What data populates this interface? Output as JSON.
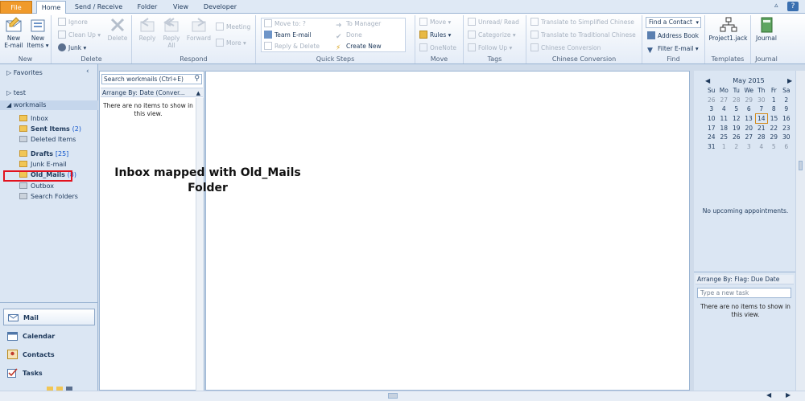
{
  "tabs": [
    "File",
    "Home",
    "Send / Receive",
    "Folder",
    "View",
    "Developer"
  ],
  "groups": {
    "new": "New",
    "delete": "Delete",
    "respond": "Respond",
    "quick_steps": "Quick Steps",
    "move": "Move",
    "tags": "Tags",
    "chinese": "Chinese Conversion",
    "find": "Find",
    "templates": "Templates",
    "journal": "Journal"
  },
  "ribbon": {
    "new_email": "New\nE-mail",
    "new_items": "New\nItems ▾",
    "ignore": "Ignore",
    "clean_up": "Clean Up ▾",
    "junk": "Junk ▾",
    "delete": "Delete",
    "reply": "Reply",
    "reply_all": "Reply\nAll",
    "forward": "Forward",
    "meeting": "Meeting",
    "more": "More ▾",
    "qs_move_to": "Move to: ?",
    "qs_team": "Team E-mail",
    "qs_reply_delete": "Reply & Delete",
    "qs_manager": "To Manager",
    "qs_done": "Done",
    "qs_create": "Create New",
    "move": "Move ▾",
    "rules": "Rules ▾",
    "onenote": "OneNote",
    "unread": "Unread/ Read",
    "categorize": "Categorize ▾",
    "follow_up": "Follow Up ▾",
    "to_simplified": "Translate to Simplified Chinese",
    "to_traditional": "Translate to Traditional Chinese",
    "chinese_conversion": "Chinese Conversion",
    "find_contact": "Find a Contact",
    "address_book": "Address Book",
    "filter_email": "Filter E-mail ▾",
    "project": "Project1.jack",
    "journal_btn": "Journal"
  },
  "nav": {
    "favorites": "Favorites",
    "test": "test",
    "workmails": "workmails",
    "folders": [
      {
        "name": "Inbox",
        "count": ""
      },
      {
        "name": "Sent Items",
        "count": "(2)"
      },
      {
        "name": "Deleted Items",
        "count": ""
      },
      {
        "name": "Drafts",
        "count": "[25]"
      },
      {
        "name": "Junk E-mail",
        "count": ""
      },
      {
        "name": "Old_Mails",
        "count": "(8)"
      },
      {
        "name": "Outbox",
        "count": ""
      },
      {
        "name": "Search Folders",
        "count": ""
      }
    ],
    "buttons": [
      "Mail",
      "Calendar",
      "Contacts",
      "Tasks"
    ]
  },
  "list": {
    "search_placeholder": "Search workmails (Ctrl+E)",
    "arrange": "Arrange By: Date (Conver...",
    "empty": "There are no items to show in this view."
  },
  "annotation": {
    "line1": "Inbox mapped with Old_Mails",
    "line2": "Folder"
  },
  "todo": {
    "month": "May 2015",
    "days": [
      "Su",
      "Mo",
      "Tu",
      "We",
      "Th",
      "Fr",
      "Sa"
    ],
    "weeks": [
      [
        "26",
        "27",
        "28",
        "29",
        "30",
        "1",
        "2"
      ],
      [
        "3",
        "4",
        "5",
        "6",
        "7",
        "8",
        "9"
      ],
      [
        "10",
        "11",
        "12",
        "13",
        "14",
        "15",
        "16"
      ],
      [
        "17",
        "18",
        "19",
        "20",
        "21",
        "22",
        "23"
      ],
      [
        "24",
        "25",
        "26",
        "27",
        "28",
        "29",
        "30"
      ],
      [
        "31",
        "1",
        "2",
        "3",
        "4",
        "5",
        "6"
      ]
    ],
    "today": "14",
    "no_appts": "No upcoming appointments.",
    "arrange": "Arrange By: Flag: Due Date",
    "task_placeholder": "Type a new task",
    "empty": "There are no items to show in this view."
  },
  "colors": {
    "file_tab": "#f09a2b",
    "highlight": "#e2121e",
    "accent": "#1e395b"
  }
}
